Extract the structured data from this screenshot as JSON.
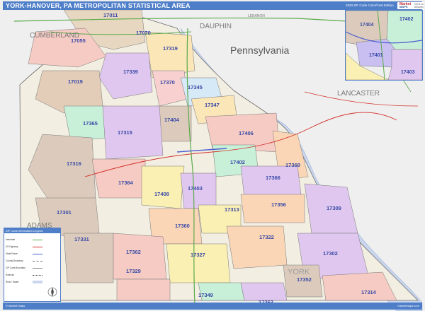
{
  "header": {
    "title": "YORK-HANOVER, PA METROPOLITAN STATISTICAL AREA",
    "edition": "2020 ZIP Code Color/Cast Edition",
    "logo_top": "Market",
    "logo_bottom": "MAPS",
    "logo_side": "Get it on Amazon"
  },
  "colors": {
    "header_blue": "#4f7ec9",
    "water": "#c9d6ee",
    "background_land": "#efefef",
    "highway_green": "#5aab4a",
    "route_red": "#d2312a",
    "boundary_gray": "#6d6d6d"
  },
  "map": {
    "state_label": "Pennsylvania",
    "counties": [
      {
        "name": "CUMBERLAND"
      },
      {
        "name": "DAUPHIN"
      },
      {
        "name": "LEBANON"
      },
      {
        "name": "LANCASTER"
      },
      {
        "name": "ADAMS"
      },
      {
        "name": "YORK"
      }
    ],
    "zips": [
      {
        "zip": "17011",
        "color": "#c8f0d8"
      },
      {
        "zip": "17070",
        "color": "#e8d7c0"
      },
      {
        "zip": "17055",
        "color": "#f6cbc3"
      },
      {
        "zip": "17319",
        "color": "#fbe6b8"
      },
      {
        "zip": "17339",
        "color": "#e0c7ef"
      },
      {
        "zip": "17019",
        "color": "#e3cdb9"
      },
      {
        "zip": "17370",
        "color": "#f7d0cf"
      },
      {
        "zip": "17345",
        "color": "#d6e9f7"
      },
      {
        "zip": "17347",
        "color": "#fbe6b8"
      },
      {
        "zip": "17365",
        "color": "#c8f0d8"
      },
      {
        "zip": "17404",
        "color": "#dccbbc"
      },
      {
        "zip": "17315",
        "color": "#e0c7ef"
      },
      {
        "zip": "17406",
        "color": "#f6cbc3"
      },
      {
        "zip": "17316",
        "color": "#dccbbc"
      },
      {
        "zip": "17402",
        "color": "#c8f0d8"
      },
      {
        "zip": "17368",
        "color": "#fbd6b6"
      },
      {
        "zip": "17364",
        "color": "#f6cbc3"
      },
      {
        "zip": "17408",
        "color": "#fbf0b3"
      },
      {
        "zip": "17403",
        "color": "#e0c7ef"
      },
      {
        "zip": "17366",
        "color": "#e0c7ef"
      },
      {
        "zip": "17356",
        "color": "#fbd6b6"
      },
      {
        "zip": "17309",
        "color": "#e0c7ef"
      },
      {
        "zip": "17301",
        "color": "#dccbbc"
      },
      {
        "zip": "17313",
        "color": "#fbf0b3"
      },
      {
        "zip": "17360",
        "color": "#fbd6b6"
      },
      {
        "zip": "17331",
        "color": "#dccbbc"
      },
      {
        "zip": "17322",
        "color": "#fbd6b6"
      },
      {
        "zip": "17362",
        "color": "#f6cbc3"
      },
      {
        "zip": "17327",
        "color": "#fbf0b3"
      },
      {
        "zip": "17302",
        "color": "#e0c7ef"
      },
      {
        "zip": "17329",
        "color": "#f6cbc3"
      },
      {
        "zip": "17352",
        "color": "#dccbbc"
      },
      {
        "zip": "17349",
        "color": "#c8f0d8"
      },
      {
        "zip": "17363",
        "color": "#e0c7ef"
      },
      {
        "zip": "17314",
        "color": "#f6cbc3"
      }
    ]
  },
  "inset": {
    "zips": [
      {
        "zip": "17404"
      },
      {
        "zip": "17402"
      },
      {
        "zip": "17401"
      },
      {
        "zip": "17403"
      }
    ]
  },
  "legend": {
    "title": "ZIP Code Information Legend",
    "rows": [
      "Interstate",
      "US Highway",
      "State Route",
      "County Boundary",
      "ZIP Code Boundary",
      "Railroad",
      "River / Water"
    ]
  },
  "footer": {
    "left": "© Market Maps",
    "right": "marketmaps.com"
  }
}
